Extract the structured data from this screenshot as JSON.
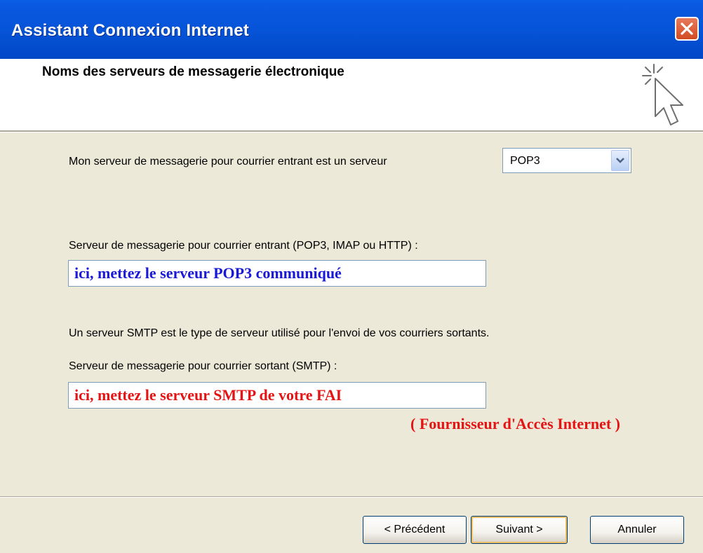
{
  "window": {
    "title": "Assistant Connexion Internet",
    "accent_color": "#0054e3",
    "close_icon": "close-icon"
  },
  "header": {
    "title": "Noms des serveurs de messagerie électronique",
    "icon": "wizard-cursor-icon"
  },
  "incoming_type": {
    "label": "Mon serveur de messagerie pour courrier entrant est un serveur",
    "selected": "POP3"
  },
  "incoming_server": {
    "label": "Serveur de messagerie pour courrier entrant (POP3, IMAP ou HTTP) :",
    "value": "ici, mettez le serveur POP3 communiqué",
    "value_color": "#1a1ad6"
  },
  "smtp_info": "Un serveur SMTP est le type de serveur utilisé pour l'envoi de vos courriers sortants.",
  "outgoing_server": {
    "label": "Serveur de messagerie pour courrier sortant (SMTP) :",
    "value": "ici, mettez le serveur SMTP de votre FAI",
    "value_color": "#e51414"
  },
  "annotation": "( Fournisseur d'Accès Internet )",
  "buttons": {
    "back": "< Précédent",
    "next": "Suivant >",
    "cancel": "Annuler"
  }
}
